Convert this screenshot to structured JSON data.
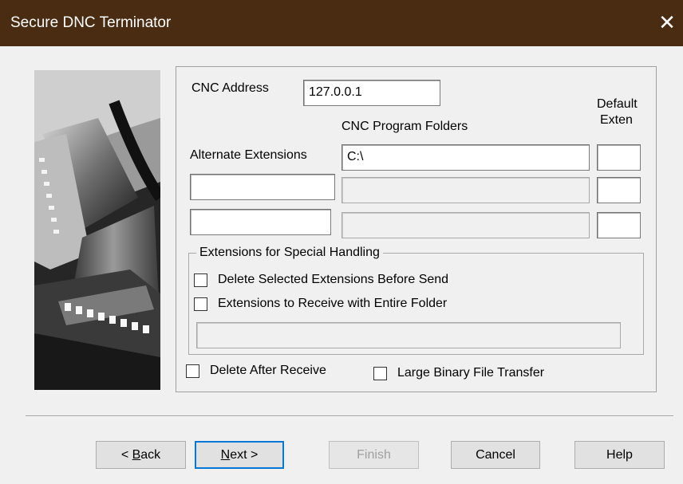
{
  "window": {
    "title": "Secure  DNC Terminator",
    "close_glyph": "✕"
  },
  "image": {
    "description_icon": "serial-connector-photo"
  },
  "form": {
    "cnc_address_label": "CNC Address",
    "cnc_address_value": "127.0.0.1",
    "default_exten_label_line1": "Default",
    "default_exten_label_line2": "Exten",
    "cnc_program_folders_label": "CNC Program Folders",
    "alternate_extensions_label": "Alternate Extensions",
    "rows": [
      {
        "alt_extension": "",
        "folder": "C:\\",
        "default_ext": ""
      },
      {
        "alt_extension": "",
        "folder": "",
        "default_ext": ""
      },
      {
        "alt_extension": "",
        "folder": "",
        "default_ext": ""
      }
    ]
  },
  "special_handling": {
    "legend": "Extensions for Special Handling",
    "delete_before_send_label": "Delete Selected Extensions Before Send",
    "delete_before_send_checked": false,
    "receive_entire_folder_label": "Extensions to Receive with Entire Folder",
    "receive_entire_folder_checked": false,
    "extensions_value": ""
  },
  "options": {
    "delete_after_receive_label": "Delete After Receive",
    "delete_after_receive_checked": false,
    "large_binary_label": "Large Binary File Transfer",
    "large_binary_checked": false
  },
  "buttons": {
    "back_prefix": "< ",
    "back_mnemonic": "B",
    "back_rest": "ack",
    "next_mnemonic": "N",
    "next_rest": "ext >",
    "finish": "Finish",
    "cancel": "Cancel",
    "help": "Help"
  }
}
